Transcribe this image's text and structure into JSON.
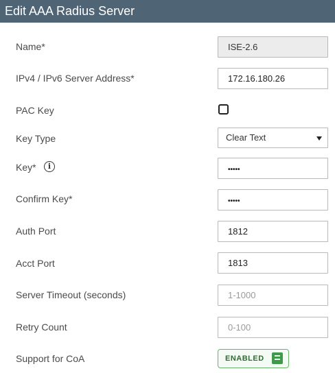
{
  "dialog": {
    "title": "Edit AAA Radius Server"
  },
  "form": {
    "name": {
      "label": "Name*",
      "value": "ISE-2.6"
    },
    "server_address": {
      "label": "IPv4 / IPv6 Server Address*",
      "value": "172.16.180.26"
    },
    "pac_key": {
      "label": "PAC Key",
      "checked": false
    },
    "key_type": {
      "label": "Key Type",
      "value": "Clear Text"
    },
    "key": {
      "label": "Key*",
      "value": "•••••",
      "info_icon": "info-icon"
    },
    "confirm_key": {
      "label": "Confirm Key*",
      "value": "•••••"
    },
    "auth_port": {
      "label": "Auth Port",
      "value": "1812"
    },
    "acct_port": {
      "label": "Acct Port",
      "value": "1813"
    },
    "server_timeout": {
      "label": "Server Timeout (seconds)",
      "placeholder": "1-1000"
    },
    "retry_count": {
      "label": "Retry Count",
      "placeholder": "0-100"
    },
    "support_coa": {
      "label": "Support for CoA",
      "toggle_text": "ENABLED",
      "enabled": true
    }
  },
  "colors": {
    "titlebar": "#4f6475",
    "toggle_on": "#3e9a48"
  }
}
